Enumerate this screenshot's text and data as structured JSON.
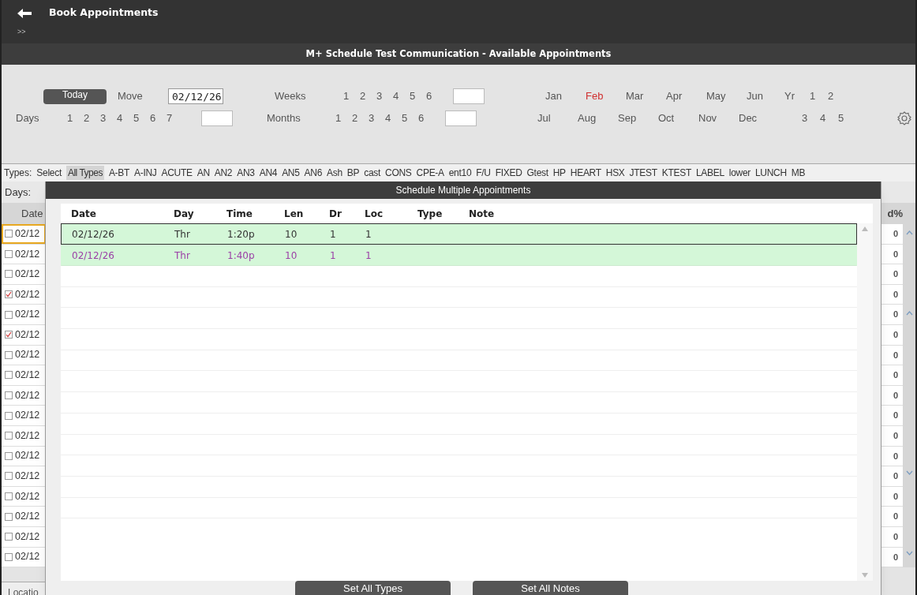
{
  "app_bar": {
    "title": "Book Appointments",
    "breadcrumb": ">>"
  },
  "page_title": "M+ Schedule Test Communication - Available Appointments",
  "controls": {
    "today_button": "Today",
    "move_label": "Move",
    "move_date": "02/12/26",
    "days_label": "Days",
    "days": [
      "1",
      "2",
      "3",
      "4",
      "5",
      "6",
      "7"
    ],
    "weeks_label": "Weeks",
    "weeks": [
      "1",
      "2",
      "3",
      "4",
      "5",
      "6"
    ],
    "months_label": "Months",
    "month_counts": [
      "1",
      "2",
      "3",
      "4",
      "5",
      "6"
    ],
    "month_names": [
      {
        "label": "Jan",
        "selected": false
      },
      {
        "label": "Feb",
        "selected": true
      },
      {
        "label": "Mar",
        "selected": false
      },
      {
        "label": "Apr",
        "selected": false
      },
      {
        "label": "May",
        "selected": false
      },
      {
        "label": "Jun",
        "selected": false
      },
      {
        "label": "Jul",
        "selected": false
      },
      {
        "label": "Aug",
        "selected": false
      },
      {
        "label": "Sep",
        "selected": false
      },
      {
        "label": "Oct",
        "selected": false
      },
      {
        "label": "Nov",
        "selected": false
      },
      {
        "label": "Dec",
        "selected": false
      }
    ],
    "year_label": "Yr",
    "years_row_1": [
      "1",
      "2"
    ],
    "years_row_2": [
      "3",
      "4",
      "5"
    ]
  },
  "types": {
    "label": "Types:",
    "items": [
      {
        "label": "Select",
        "selected": false
      },
      {
        "label": "All Types",
        "selected": true
      },
      {
        "label": "A-BT",
        "selected": false
      },
      {
        "label": "A-INJ",
        "selected": false
      },
      {
        "label": "ACUTE",
        "selected": false
      },
      {
        "label": "AN",
        "selected": false
      },
      {
        "label": "AN2",
        "selected": false
      },
      {
        "label": "AN3",
        "selected": false
      },
      {
        "label": "AN4",
        "selected": false
      },
      {
        "label": "AN5",
        "selected": false
      },
      {
        "label": "AN6",
        "selected": false
      },
      {
        "label": "Ash",
        "selected": false
      },
      {
        "label": "BP",
        "selected": false
      },
      {
        "label": "cast",
        "selected": false
      },
      {
        "label": "CONS",
        "selected": false
      },
      {
        "label": "CPE-A",
        "selected": false
      },
      {
        "label": "ent10",
        "selected": false
      },
      {
        "label": "F/U",
        "selected": false
      },
      {
        "label": "FIXED",
        "selected": false
      },
      {
        "label": "Gtest",
        "selected": false
      },
      {
        "label": "HP",
        "selected": false
      },
      {
        "label": "HEART",
        "selected": false
      },
      {
        "label": "HSX",
        "selected": false
      },
      {
        "label": "JTEST",
        "selected": false
      },
      {
        "label": "KTEST",
        "selected": false
      },
      {
        "label": "LABEL",
        "selected": false
      },
      {
        "label": "lower",
        "selected": false
      },
      {
        "label": "LUNCH",
        "selected": false
      },
      {
        "label": "MB",
        "selected": false
      }
    ]
  },
  "days_filter_label": "Days:",
  "table": {
    "columns": [
      "Date",
      "d%"
    ],
    "rows": [
      {
        "date": "02/12",
        "checked": false,
        "focused": true,
        "value": "0"
      },
      {
        "date": "02/12",
        "checked": false,
        "focused": false,
        "value": "0"
      },
      {
        "date": "02/12",
        "checked": false,
        "focused": false,
        "value": "0"
      },
      {
        "date": "02/12",
        "checked": true,
        "focused": false,
        "value": "0"
      },
      {
        "date": "02/12",
        "checked": false,
        "focused": false,
        "value": "0"
      },
      {
        "date": "02/12",
        "checked": true,
        "focused": false,
        "value": "0"
      },
      {
        "date": "02/12",
        "checked": false,
        "focused": false,
        "value": "0"
      },
      {
        "date": "02/12",
        "checked": false,
        "focused": false,
        "value": "0"
      },
      {
        "date": "02/12",
        "checked": false,
        "focused": false,
        "value": "0"
      },
      {
        "date": "02/12",
        "checked": false,
        "focused": false,
        "value": "0"
      },
      {
        "date": "02/12",
        "checked": false,
        "focused": false,
        "value": "0"
      },
      {
        "date": "02/12",
        "checked": false,
        "focused": false,
        "value": "0"
      },
      {
        "date": "02/12",
        "checked": false,
        "focused": false,
        "value": "0"
      },
      {
        "date": "02/12",
        "checked": false,
        "focused": false,
        "value": "0"
      },
      {
        "date": "02/12",
        "checked": false,
        "focused": false,
        "value": "0"
      },
      {
        "date": "02/12",
        "checked": false,
        "focused": false,
        "value": "0"
      },
      {
        "date": "02/12",
        "checked": false,
        "focused": false,
        "value": "0"
      }
    ]
  },
  "status_bar": "Locatio",
  "modal": {
    "title": "Schedule Multiple Appointments",
    "columns": [
      "Date",
      "Day",
      "Time",
      "Len",
      "Dr",
      "Loc",
      "Type",
      "Note"
    ],
    "rows": [
      {
        "cells": [
          "02/12/26",
          "Thr",
          "1:20p",
          "10",
          "1",
          "1"
        ],
        "selected": true,
        "color": "#333333"
      },
      {
        "cells": [
          "02/12/26",
          "Thr",
          "1:40p",
          "10",
          "1",
          "1"
        ],
        "selected": false,
        "color": "#9b3fa6"
      }
    ],
    "buttons": [
      "Set All Types",
      "Set All Notes"
    ]
  }
}
